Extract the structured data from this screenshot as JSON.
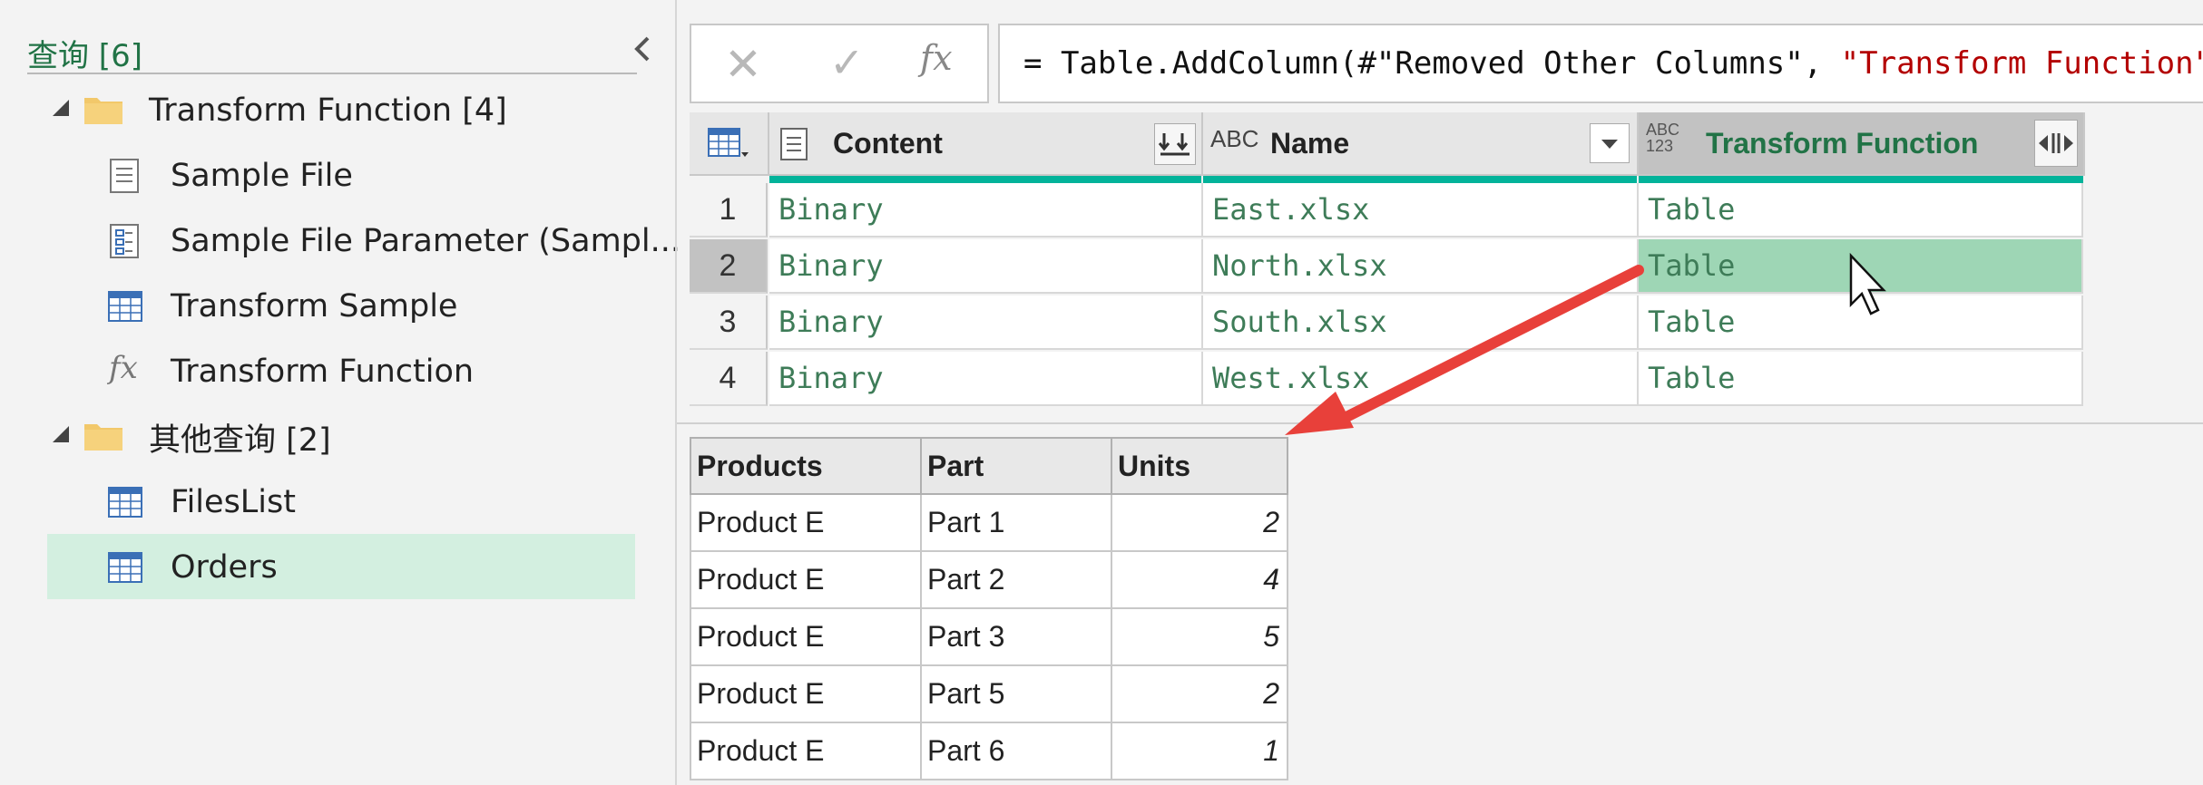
{
  "queries_pane": {
    "title": "查询 [6]",
    "groups": [
      {
        "label": "Transform Function [4]",
        "items": [
          {
            "label": "Sample File",
            "icon": "document-icon"
          },
          {
            "label": "Sample File Parameter (Sampl...",
            "icon": "parameter-icon"
          },
          {
            "label": "Transform Sample",
            "icon": "table-icon"
          },
          {
            "label": "Transform Function",
            "icon": "function-icon"
          }
        ]
      },
      {
        "label": "其他查询 [2]",
        "items": [
          {
            "label": "FilesList",
            "icon": "table-icon"
          },
          {
            "label": "Orders",
            "icon": "table-icon",
            "selected": true
          }
        ]
      }
    ]
  },
  "formula_bar": {
    "cancel_icon": "✕",
    "commit_icon": "✓",
    "fx_label": "fx",
    "prefix": "= Table.AddColumn(#\"Removed Other Columns\", ",
    "string_arg": "\"Transform Function\"",
    "suffix": ","
  },
  "grid": {
    "columns": [
      {
        "name": "Content",
        "type_icon": "binary-type-icon",
        "header_button": "expand-icon"
      },
      {
        "name": "Name",
        "type_icon": "ABC",
        "header_button": "filter-dropdown-icon"
      },
      {
        "name": "Transform Function",
        "type_icon": "ABC 123",
        "header_button": "expand-table-icon"
      }
    ],
    "rows": [
      {
        "num": "1",
        "content": "Binary",
        "name": "East.xlsx",
        "fn": "Table"
      },
      {
        "num": "2",
        "content": "Binary",
        "name": "North.xlsx",
        "fn": "Table"
      },
      {
        "num": "3",
        "content": "Binary",
        "name": "South.xlsx",
        "fn": "Table"
      },
      {
        "num": "4",
        "content": "Binary",
        "name": "West.xlsx",
        "fn": "Table"
      }
    ],
    "selected_row": 2,
    "accent_color": "#02b39a",
    "highlight_color": "#9ed6b5"
  },
  "preview": {
    "headers": [
      "Products",
      "Part",
      "Units"
    ],
    "rows": [
      [
        "Product E",
        "Part 1",
        "2"
      ],
      [
        "Product E",
        "Part 2",
        "4"
      ],
      [
        "Product E",
        "Part 3",
        "5"
      ],
      [
        "Product E",
        "Part 5",
        "2"
      ],
      [
        "Product E",
        "Part 6",
        "1"
      ]
    ]
  },
  "annotation_arrow_color": "#e8403a",
  "brand_green": "#217346"
}
